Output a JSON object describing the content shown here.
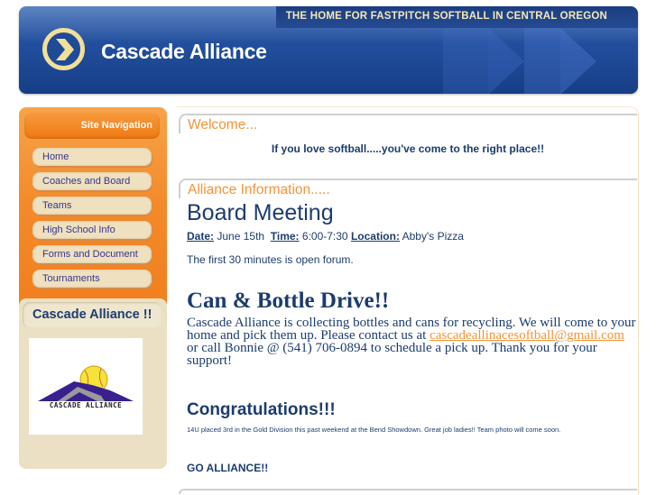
{
  "header": {
    "tagline": "THE HOME FOR FASTPITCH SOFTBALL IN CENTRAL OREGON",
    "site_title": "Cascade Alliance",
    "logo_icon": "chevron-right-circle-icon"
  },
  "sidebar": {
    "nav_title": "Site Navigation",
    "items": [
      {
        "label": "Home"
      },
      {
        "label": "Coaches and Board"
      },
      {
        "label": "Teams"
      },
      {
        "label": "High School Info"
      },
      {
        "label": "Forms and Document"
      },
      {
        "label": "Tournaments"
      }
    ],
    "promo_title": "Cascade Alliance !!",
    "promo_logo_text": "CASCADE ALLIANCE"
  },
  "main": {
    "welcome": {
      "title": "Welcome...",
      "tagline": "If you love softball.....you've come to the right place!!"
    },
    "info": {
      "title": "Alliance Information.....",
      "board": {
        "heading": "Board Meeting",
        "date_label": "Date:",
        "date_value": "June 15th",
        "time_label": "Time:",
        "time_value": "6:00-7:30",
        "location_label": "Location:",
        "location_value": "Abby's Pizza",
        "note": "The first 30 minutes is open forum."
      },
      "drive": {
        "heading": "Can & Bottle Drive!!",
        "text_before": "Cascade Alliance is collecting bottles and cans for recycling. We will come to your home and pick them up. Please contact us at ",
        "email": "cascadeallinacesoftball@gmail.com",
        "text_after": " or call Bonnie @ (541) 706-0894 to schedule a pick up. Thank you for your support!"
      },
      "congrats": {
        "heading": "Congratulations!!!",
        "text": "14U placed 3rd in the Gold Division this past weekend at the Bend Showdown. Great job ladies!! Team photo will come soon."
      },
      "closing": "GO ALLIANCE!!"
    }
  },
  "colors": {
    "banner_blue": "#214e9c",
    "accent_orange": "#f39437",
    "nav_orange": "#f38a2a",
    "text_navy": "#1c3c6e",
    "nav_link": "#34368a",
    "tan": "#ece0c4",
    "tagline_cream": "#f4e7b9"
  }
}
